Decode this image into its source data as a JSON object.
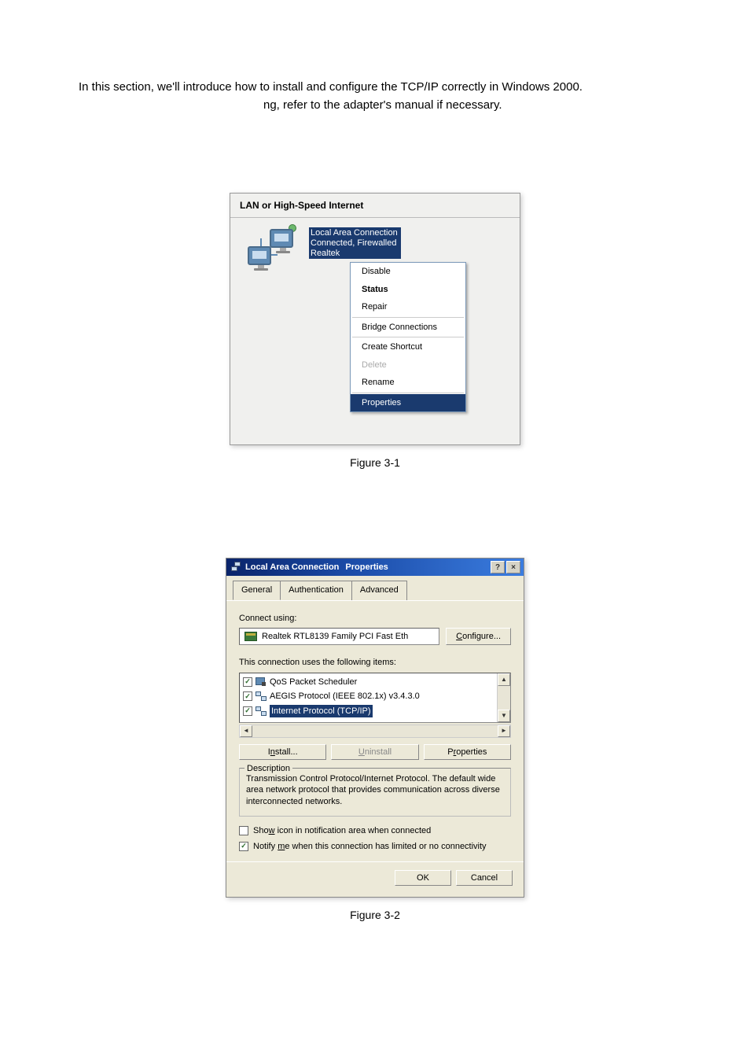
{
  "intro": {
    "line1": "In this section, we'll introduce how to install and configure the TCP/IP correctly in Windows 2000.",
    "line2_suffix": "ng, refer to the adapter's manual if necessary."
  },
  "fig1": {
    "header": "LAN or High-Speed Internet",
    "conn_name": "Local Area Connection",
    "conn_status": "Connected, Firewalled",
    "conn_adapter": "Realtek",
    "menu": {
      "disable": "Disable",
      "status": "Status",
      "repair": "Repair",
      "bridge": "Bridge Connections",
      "shortcut": "Create Shortcut",
      "delete": "Delete",
      "rename": "Rename",
      "properties": "Properties"
    },
    "caption": "Figure 3-1"
  },
  "fig2": {
    "title_a": "Local Area Connection",
    "title_b": "Properties",
    "help_glyph": "?",
    "close_glyph": "×",
    "tabs": {
      "general": "General",
      "auth": "Authentication",
      "adv": "Advanced"
    },
    "connect_using": "Connect using:",
    "adapter_name": "Realtek RTL8139 Family PCI Fast Eth",
    "configure_btn": "Configure...",
    "uses_items": "This connection uses the following items:",
    "items": {
      "qos": "QoS Packet Scheduler",
      "aegis": "AEGIS Protocol (IEEE 802.1x) v3.4.3.0",
      "tcpip": "Internet Protocol (TCP/IP)"
    },
    "install_btn": "Install...",
    "uninstall_btn": "Uninstall",
    "properties_btn": "Properties",
    "description_label": "Description",
    "description_text": "Transmission Control Protocol/Internet Protocol. The default wide area network protocol that provides communication across diverse interconnected networks.",
    "show_icon": "Show icon in notification area when connected",
    "notify_limited": "Notify me when this connection has limited or no connectivity",
    "ok_btn": "OK",
    "cancel_btn": "Cancel",
    "caption": "Figure 3-2"
  }
}
